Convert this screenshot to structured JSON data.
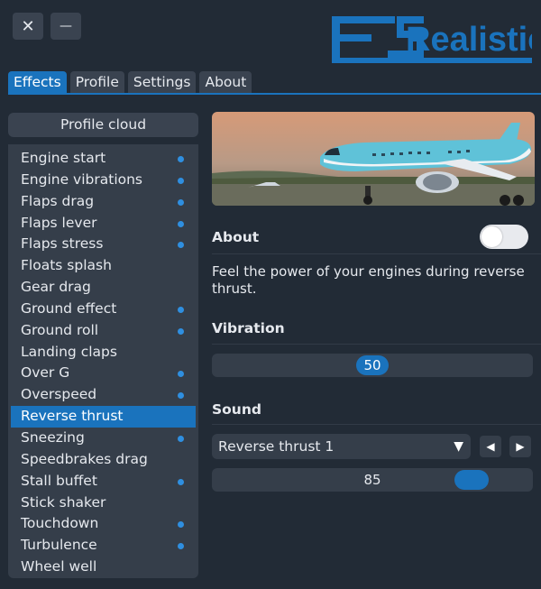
{
  "window": {
    "close_label": "✕",
    "minimize_label": "—"
  },
  "logo": {
    "text": "FSRealistic"
  },
  "tabs": [
    {
      "label": "Effects"
    },
    {
      "label": "Profile"
    },
    {
      "label": "Settings"
    },
    {
      "label": "About"
    }
  ],
  "sidebar": {
    "profile_cloud": "Profile cloud",
    "effects": [
      {
        "label": "Engine start",
        "dot": true
      },
      {
        "label": "Engine vibrations",
        "dot": true
      },
      {
        "label": "Flaps drag",
        "dot": true
      },
      {
        "label": "Flaps lever",
        "dot": true
      },
      {
        "label": "Flaps stress",
        "dot": true
      },
      {
        "label": "Floats splash",
        "dot": false
      },
      {
        "label": "Gear drag",
        "dot": false
      },
      {
        "label": "Ground effect",
        "dot": true
      },
      {
        "label": "Ground roll",
        "dot": true
      },
      {
        "label": "Landing claps",
        "dot": false
      },
      {
        "label": "Over G",
        "dot": true
      },
      {
        "label": "Overspeed",
        "dot": true
      },
      {
        "label": "Reverse thrust",
        "dot": false
      },
      {
        "label": "Sneezing",
        "dot": true
      },
      {
        "label": "Speedbrakes drag",
        "dot": false
      },
      {
        "label": "Stall buffet",
        "dot": true
      },
      {
        "label": "Stick shaker",
        "dot": false
      },
      {
        "label": "Touchdown",
        "dot": true
      },
      {
        "label": "Turbulence",
        "dot": true
      },
      {
        "label": "Wheel well",
        "dot": false
      }
    ],
    "selected_index": 12
  },
  "main": {
    "about_title": "About",
    "about_toggle_on": false,
    "description": "Feel the power of your engines during reverse thrust.",
    "vibration_title": "Vibration",
    "vibration_value": "50",
    "vibration_fraction": 0.5,
    "sound_title": "Sound",
    "sound_selected": "Reverse thrust 1",
    "sound_volume": "85",
    "sound_volume_fraction": 0.85
  },
  "colors": {
    "accent": "#1a73bd",
    "background": "#222b36",
    "panel": "#353e4a",
    "dot": "#2f8fe0"
  }
}
